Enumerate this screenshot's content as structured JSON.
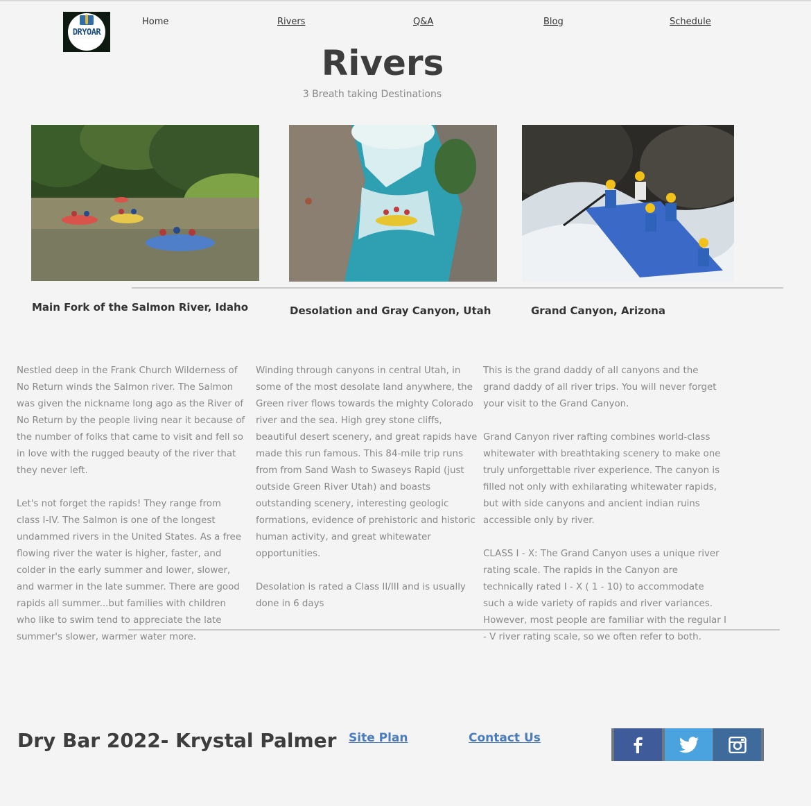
{
  "logo": {
    "text": "DRYOAR"
  },
  "nav": {
    "home": "Home",
    "rivers": "Rivers",
    "qa": " Q&A",
    "blog": "Blog",
    "schedule": "Schedule"
  },
  "page": {
    "title": "Rivers",
    "subtitle": "3 Breath taking Destinations"
  },
  "rivers": [
    {
      "name": "Main Fork of the Salmon River, Idaho",
      "paragraphs": [
        "Nestled deep in the Frank Church Wilderness of No Return winds the Salmon river. The Salmon was given the nickname long ago as the River of No Return by the people living near it because of the number of folks that came to visit and fell so in love with the rugged beauty of the river that they never left.",
        "Let's not forget the rapids! They range from class I-IV. The Salmon is one of the longest undammed rivers in the United States. As a free flowing river the water is higher, faster, and colder in the early summer and lower, slower, and warmer in the late summer. There are good rapids all summer...but families with children who like to swim tend to appreciate the late summer's slower, warmer water more."
      ]
    },
    {
      "name": "Desolation and Gray Canyon, Utah",
      "paragraphs": [
        "Winding through canyons in central Utah, in some of the most desolate land anywhere, the Green river flows towards the mighty Colorado river and the sea. High grey stone cliffs, beautiful desert scenery, and great rapids have made this run famous. This 84-mile trip runs from from Sand Wash to Swaseys Rapid (just outside Green River Utah) and boasts outstanding scenery, interesting geologic formations, evidence of prehistoric and historic human activity, and great whitewater opportunities.",
        "Desolation is rated a Class II/III and is usually done in 6 days"
      ]
    },
    {
      "name": "Grand Canyon, Arizona",
      "paragraphs": [
        "This is the grand daddy of all canyons and the grand daddy of all river trips. You will never forget your visit to the Grand Canyon.",
        "Grand Canyon river rafting combines world-class whitewater with breathtaking scenery to make one truly unforgettable river experience. The canyon is filled not only with exhilarating whitewater rapids, but with side canyons and ancient indian ruins accessible only by river.",
        "CLASS I - X: The Grand Canyon uses a unique river rating scale. The rapids in the Canyon are technically rated I - X ( 1 - 10) to accommodate such a wide variety of rapids and river variances. However, most people are familiar with the regular I - V river rating scale, so we often refer to both."
      ]
    }
  ],
  "footer": {
    "title": "Dry Bar 2022- Krystal Palmer",
    "site_plan": "Site Plan",
    "contact": "Contact Us",
    "social": [
      "facebook-icon",
      "twitter-icon",
      "instagram-icon"
    ]
  },
  "colors": {
    "background": "#f4f4f4",
    "link": "#4a7dc0",
    "facebook": "#3f5b99",
    "twitter": "#4aa3df",
    "instagram": "#3e6a9c"
  }
}
